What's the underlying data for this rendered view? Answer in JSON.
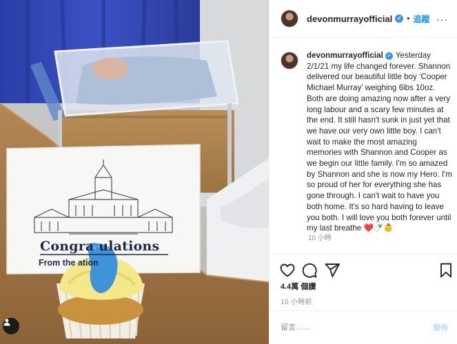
{
  "photo": {
    "card_title": "Congra  ulations",
    "card_subtitle": "From the        ation",
    "user_tag_icon": "person-icon"
  },
  "header": {
    "username": "devonmurrayofficial",
    "verified_icon": "verified-badge-icon",
    "separator": "•",
    "follow_label": "追蹤",
    "more_icon": "ellipsis-icon"
  },
  "caption": {
    "username": "devonmurrayofficial",
    "text": "Yesterday 2/1/21 my life changed forever. Shannon delivered our beautiful little boy ‘Cooper Michael Murray’ weighing 6lbs 10oz. Both are doing amazing now after a very long labour and a scary few minutes at the end. It still hasn't sunk in just yet that we have our very own little boy. I can't wait to make the most amazing memories with Shannon and Cooper as we begin our little family. I'm so amazed by Shannon and she is now my Hero. I'm so proud of her for everything she has gone through. I can't wait to have you both home. It's so hard having to leave you both. I will love you both forever until my last breathe ❤️🍼👶",
    "time": "10 小時"
  },
  "actions": {
    "like_icon": "heart-icon",
    "comment_icon": "comment-bubble-icon",
    "share_icon": "paper-plane-icon",
    "save_icon": "bookmark-icon"
  },
  "stats": {
    "likes": "4.4萬 個讚",
    "post_time": "10 小時前"
  },
  "comment": {
    "placeholder": "留言……",
    "post_label": "發佈"
  },
  "colors": {
    "accent": "#0095f6",
    "verified": "#3897f0",
    "post_disabled": "#b2dffc",
    "muted": "#8e8e8e"
  }
}
